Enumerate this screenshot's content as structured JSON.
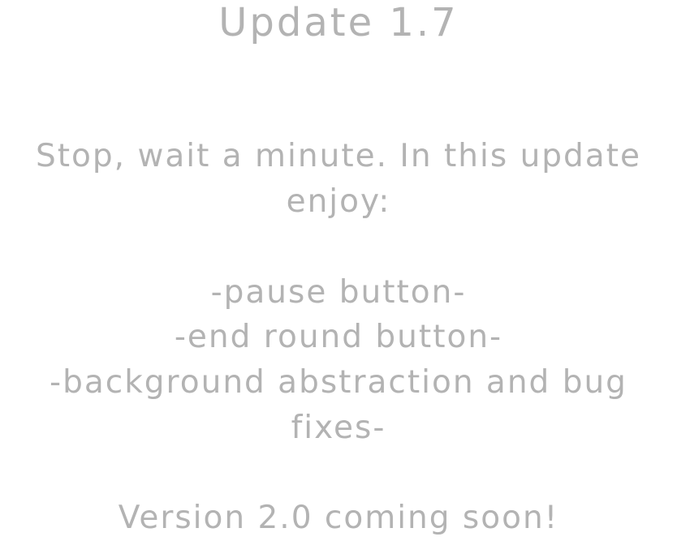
{
  "update_notes": {
    "title": "Update 1.7",
    "intro_line1": "Stop, wait a minute. In this update",
    "intro_line2": "enjoy:",
    "feature1": "-pause button-",
    "feature2": "-end round button-",
    "feature3_line1": "-background abstraction and bug",
    "feature3_line2": "fixes-",
    "footer": "Version 2.0 coming soon!"
  },
  "colors": {
    "background": "#ffffff",
    "text": "#b3b3b3"
  }
}
